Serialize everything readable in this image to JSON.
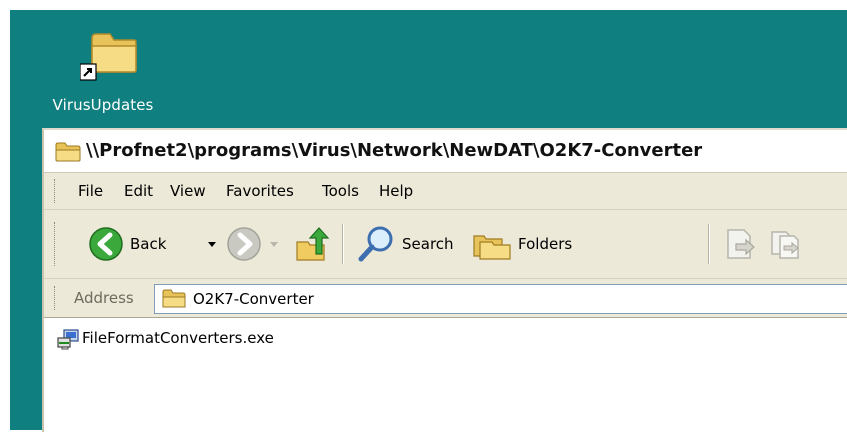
{
  "desktop": {
    "background_color": "#0f7f7f",
    "icon": {
      "label": "VirusUpdates",
      "icon_name": "folder-shortcut-icon"
    }
  },
  "window": {
    "title": "\\\\Profnet2\\programs\\Virus\\Network\\NewDAT\\O2K7-Converter",
    "menu": {
      "items": [
        {
          "label": "File"
        },
        {
          "label": "Edit"
        },
        {
          "label": "View"
        },
        {
          "label": "Favorites"
        },
        {
          "label": "Tools"
        },
        {
          "label": "Help"
        }
      ]
    },
    "toolbar": {
      "back_label": "Back",
      "search_label": "Search",
      "folders_label": "Folders"
    },
    "address": {
      "label": "Address",
      "value": "O2K7-Converter"
    },
    "files": [
      {
        "name": "FileFormatConverters.exe",
        "icon_name": "installer-exe-icon"
      }
    ]
  }
}
